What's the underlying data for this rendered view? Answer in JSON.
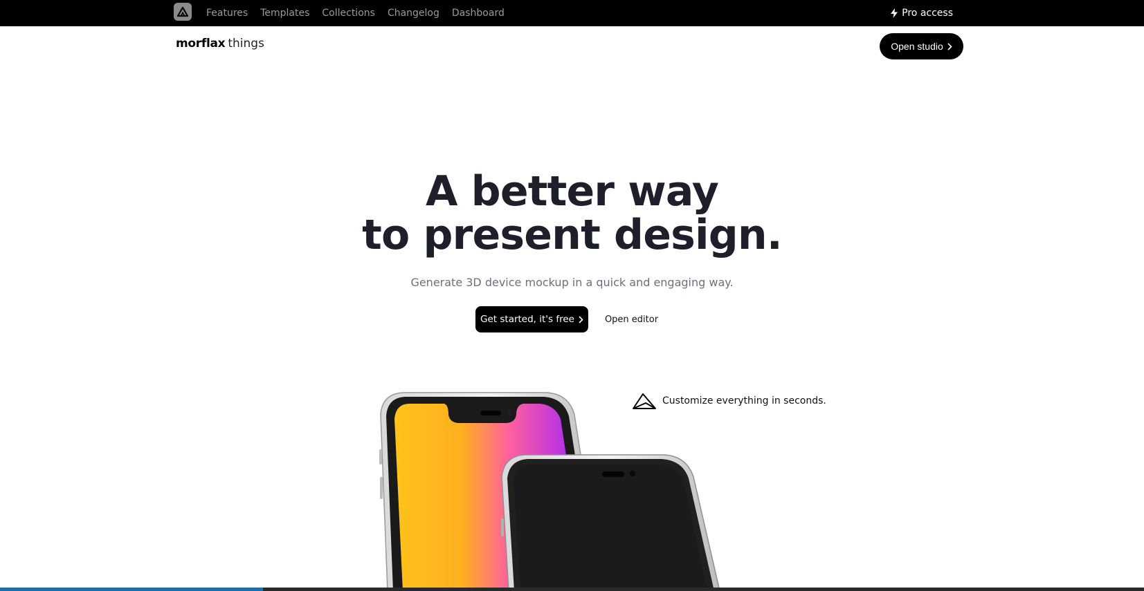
{
  "topbar": {
    "logo_icon": "morflax-logo-icon",
    "nav": [
      {
        "label": "Features"
      },
      {
        "label": "Templates"
      },
      {
        "label": "Collections"
      },
      {
        "label": "Changelog"
      },
      {
        "label": "Dashboard"
      }
    ],
    "pro_access": {
      "icon": "lightning-icon",
      "label": "Pro access"
    }
  },
  "header": {
    "brand_strong": "morflax",
    "brand_light": "things",
    "open_studio_label": "Open studio",
    "open_studio_icon": "chevron-right-icon"
  },
  "hero": {
    "title_line1": "A better way",
    "title_line2": "to present design.",
    "subtitle": "Generate 3D device mockup in a quick and engaging way.",
    "primary_cta": "Get started, it's free",
    "secondary_cta": "Open editor"
  },
  "feature": {
    "icon": "paper-plane-icon",
    "text": "Customize everything in seconds."
  },
  "colors": {
    "black": "#000000",
    "title": "#1e1f2b",
    "subtitle": "#6c6f80",
    "nav_text": "#9a9a9a",
    "gradient_start": "#ffc21a",
    "gradient_mid": "#ff5fa0",
    "gradient_end": "#9b1fff"
  }
}
